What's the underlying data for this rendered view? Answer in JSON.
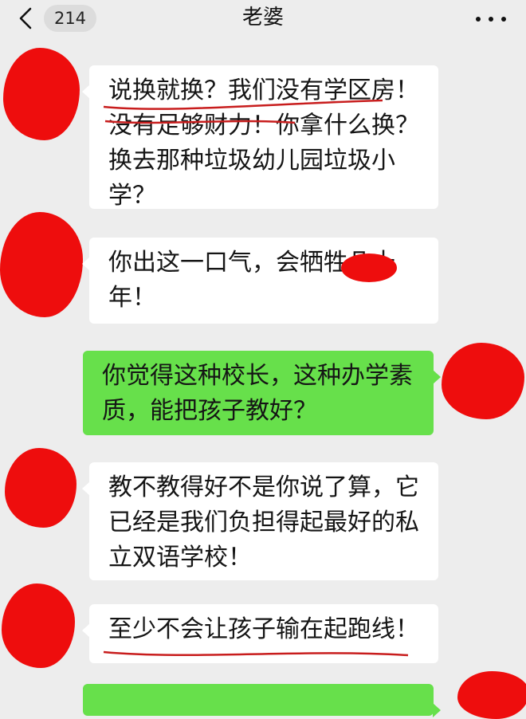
{
  "header": {
    "unread_count": "214",
    "title": "老婆",
    "more_icon": "ellipsis-icon",
    "back_icon": "chevron-left-icon"
  },
  "colors": {
    "background": "#ededed",
    "incoming_bubble": "#ffffff",
    "outgoing_bubble": "#67e04b",
    "redaction": "#ee0d0d"
  },
  "messages": [
    {
      "sender": "them",
      "text": "说换就换？我们没有学区房！没有足够财力！你拿什么换？换去那种垃圾幼儿园垃圾小学？"
    },
    {
      "sender": "them",
      "text": "你出这一口气，会牺牲几十年！"
    },
    {
      "sender": "me",
      "text": "你觉得这种校长，这种办学素质，能把孩子教好？"
    },
    {
      "sender": "them",
      "text": "教不教得好不是你说了算，它已经是我们负担得起最好的私立双语学校！"
    },
    {
      "sender": "them",
      "text": "至少不会让孩子输在起跑线！"
    }
  ]
}
